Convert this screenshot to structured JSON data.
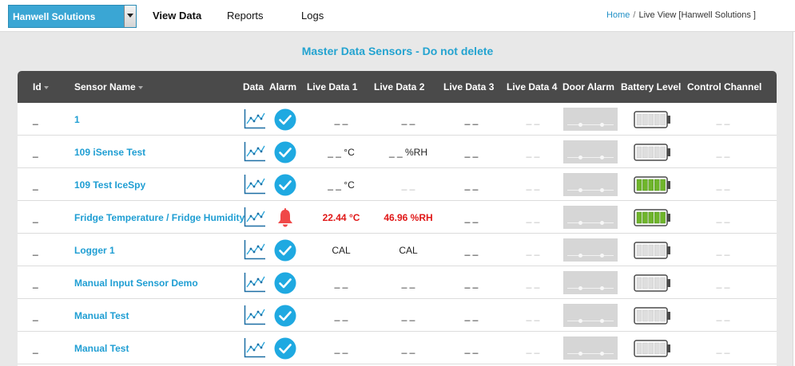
{
  "company_select": {
    "value": "Hanwell Solutions"
  },
  "nav": {
    "view_data": "View Data",
    "reports": "Reports",
    "logs": "Logs"
  },
  "breadcrumb": {
    "home": "Home",
    "separator": "/",
    "current": "Live View [Hanwell Solutions ]"
  },
  "page_title": "Master Data Sensors - Do not delete",
  "columns": {
    "id": "Id",
    "sensor_name": "Sensor Name",
    "data": "Data",
    "alarm": "Alarm",
    "live1": "Live Data 1",
    "live2": "Live Data 2",
    "live3": "Live Data 3",
    "live4": "Live Data 4",
    "door": "Door Alarm",
    "battery": "Battery Level",
    "control": "Control Channel"
  },
  "colors": {
    "accent": "#23a3d0",
    "alarm_ok": "#1fa9e1",
    "alarm_active": "#f04848",
    "battery_full": "#6fb52b",
    "header_bg": "#4a4a4a",
    "alert_text": "#e01818"
  },
  "rows": [
    {
      "id": "_",
      "name": "1",
      "alarm": "ok",
      "live1": "_ _",
      "live2": "_ _",
      "live3": "_ _",
      "live4": "_ _",
      "battery": "empty",
      "control": "_ _"
    },
    {
      "id": "_",
      "name": "109 iSense Test",
      "alarm": "ok",
      "live1": "_ _ °C",
      "live2": "_ _ %RH",
      "live3": "_ _",
      "live4": "_ _",
      "battery": "empty",
      "control": "_ _"
    },
    {
      "id": "_",
      "name": "109 Test IceSpy",
      "alarm": "ok",
      "live1": "_ _ °C",
      "live2": "_ _",
      "live3": "_ _",
      "live4": "_ _",
      "battery": "full",
      "control": "_ _"
    },
    {
      "id": "_",
      "name": "Fridge Temperature / Fridge Humidity",
      "alarm": "active",
      "live1": "22.44 °C",
      "live2": "46.96 %RH",
      "live3": "_ _",
      "live4": "_ _",
      "battery": "full",
      "control": "_ _"
    },
    {
      "id": "_",
      "name": "Logger 1",
      "alarm": "ok",
      "live1": "CAL",
      "live2": "CAL",
      "live3": "_ _",
      "live4": "_ _",
      "battery": "empty",
      "control": "_ _"
    },
    {
      "id": "_",
      "name": "Manual Input Sensor Demo",
      "alarm": "ok",
      "live1": "_ _",
      "live2": "_ _",
      "live3": "_ _",
      "live4": "_ _",
      "battery": "empty",
      "control": "_ _"
    },
    {
      "id": "_",
      "name": "Manual Test",
      "alarm": "ok",
      "live1": "_ _",
      "live2": "_ _",
      "live3": "_ _",
      "live4": "_ _",
      "battery": "empty",
      "control": "_ _"
    },
    {
      "id": "_",
      "name": "Manual Test",
      "alarm": "ok",
      "live1": "_ _",
      "live2": "_ _",
      "live3": "_ _",
      "live4": "_ _",
      "battery": "empty",
      "control": "_ _"
    }
  ]
}
